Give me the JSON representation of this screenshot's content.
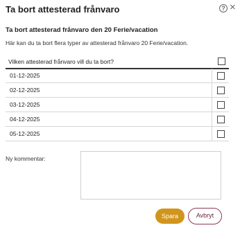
{
  "dialog": {
    "title": "Ta bort attesterad frånvaro",
    "help_glyph": "?",
    "close_glyph": "×"
  },
  "main": {
    "heading": "Ta bort attesterad frånvaro den 20 Ferie/vacation",
    "description": "Här kan du ta bort flera typer av attesterad frånvaro 20 Ferie/vacation.",
    "question": "Vilken attesterad frånvaro vill du ta bort?",
    "dates": [
      {
        "label": "01-12-2025",
        "checked": false
      },
      {
        "label": "02-12-2025",
        "checked": false
      },
      {
        "label": "03-12-2025",
        "checked": false
      },
      {
        "label": "04-12-2025",
        "checked": false
      },
      {
        "label": "05-12-2025",
        "checked": false
      }
    ]
  },
  "comment": {
    "label": "Ny kommentar:",
    "value": ""
  },
  "actions": {
    "save": "Spara",
    "cancel": "Avbryt"
  },
  "colors": {
    "save_bg": "#d1951c",
    "cancel_border": "#8b3a56"
  }
}
